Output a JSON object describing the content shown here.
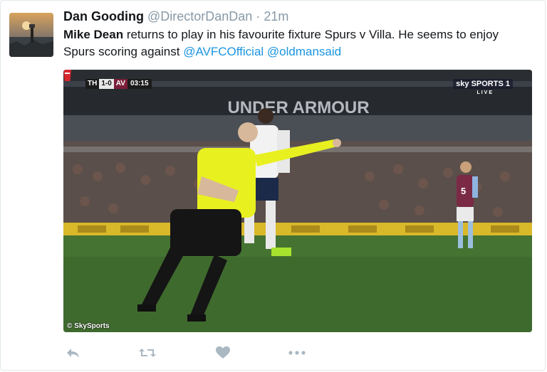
{
  "tweet": {
    "author_name": "Dan Gooding",
    "handle": "@DirectorDanDan",
    "separator": "·",
    "time": "21m",
    "text_bold": "Mike Dean",
    "text_rest": " returns to play in his favourite fixture Spurs v Villa. He seems to enjoy Spurs scoring against ",
    "mention_1": "@AVFCOfficial",
    "mention_2": "@oldmansaid"
  },
  "media": {
    "scorebug_home": "TH",
    "scorebug_score": "1-0",
    "scorebug_away": "AV",
    "scorebug_time": "03:15",
    "broadcaster": "sky SPORTS 1",
    "live_label": "LIVE",
    "board_text": "UNDER ARMOUR",
    "credit": "© SkySports"
  },
  "actions": {
    "reply": "reply-icon",
    "retweet": "retweet-icon",
    "like": "heart-icon",
    "more": "more-icon"
  },
  "colors": {
    "link": "#1b95e0",
    "icon": "#aab8c2",
    "referee_shirt": "#e8f020",
    "pitch": "#3f6a2e"
  }
}
